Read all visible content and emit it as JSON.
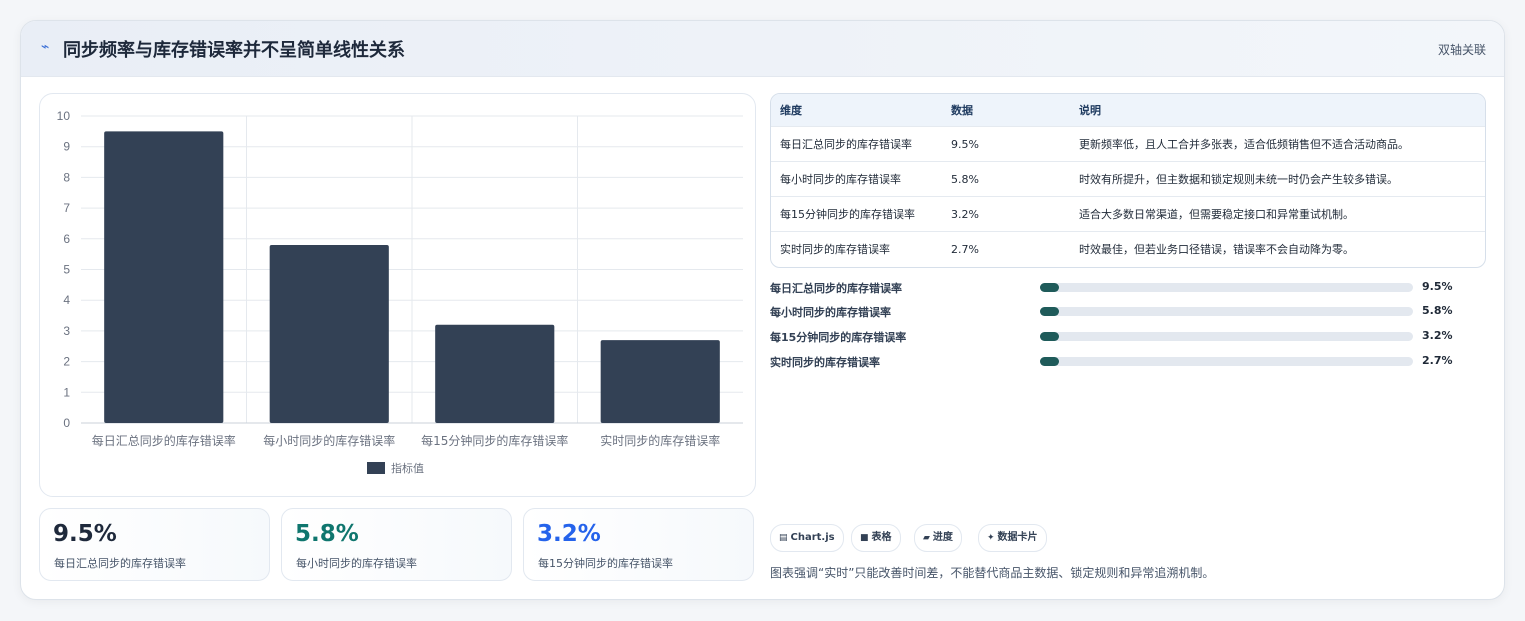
{
  "header": {
    "icon": "lightning-icon",
    "title": "同步频率与库存错误率并不呈简单线性关系",
    "tag": "双轴关联"
  },
  "chart_data": {
    "type": "bar",
    "categories": [
      "每日汇总同步的库存错误率",
      "每小时同步的库存错误率",
      "每15分钟同步的库存错误率",
      "实时同步的库存错误率"
    ],
    "series": [
      {
        "name": "指标值",
        "values": [
          9.5,
          5.8,
          3.2,
          2.7
        ]
      }
    ],
    "ylim": [
      0,
      10
    ],
    "yticks": [
      0,
      1,
      2,
      3,
      4,
      5,
      6,
      7,
      8,
      9,
      10
    ],
    "legend": "bottom",
    "grid": true,
    "bar_color": "#334155"
  },
  "stats": [
    {
      "value": "9.5%",
      "label": "每日汇总同步的库存错误率",
      "color": "#1e293b"
    },
    {
      "value": "5.8%",
      "label": "每小时同步的库存错误率",
      "color": "#0f766e"
    },
    {
      "value": "3.2%",
      "label": "每15分钟同步的库存错误率",
      "color": "#2563eb"
    }
  ],
  "table": {
    "headers": [
      "维度",
      "数据",
      "说明"
    ],
    "rows": [
      [
        "每日汇总同步的库存错误率",
        "9.5%",
        "更新频率低，且人工合并多张表，适合低频销售但不适合活动商品。"
      ],
      [
        "每小时同步的库存错误率",
        "5.8%",
        "时效有所提升，但主数据和锁定规则未统一时仍会产生较多错误。"
      ],
      [
        "每15分钟同步的库存错误率",
        "3.2%",
        "适合大多数日常渠道，但需要稳定接口和异常重试机制。"
      ],
      [
        "实时同步的库存错误率",
        "2.7%",
        "时效最佳，但若业务口径错误，错误率不会自动降为零。"
      ]
    ]
  },
  "progress": [
    {
      "label": "每日汇总同步的库存错误率",
      "value": "9.5%",
      "fill": 0.05
    },
    {
      "label": "每小时同步的库存错误率",
      "value": "5.8%",
      "fill": 0.05
    },
    {
      "label": "每15分钟同步的库存错误率",
      "value": "3.2%",
      "fill": 0.05
    },
    {
      "label": "实时同步的库存错误率",
      "value": "2.7%",
      "fill": 0.05
    }
  ],
  "chips": [
    {
      "icon": "chart-icon",
      "glyph": "▤",
      "label": "Chart.js"
    },
    {
      "icon": "table-icon",
      "glyph": "■",
      "label": "表格"
    },
    {
      "icon": "progress-icon",
      "glyph": "▰",
      "label": "进度"
    },
    {
      "icon": "sparkle-icon",
      "glyph": "✦",
      "label": "数据卡片"
    }
  ],
  "note": "图表强调“实时”只能改善时间差，不能替代商品主数据、锁定规则和异常追溯机制。"
}
